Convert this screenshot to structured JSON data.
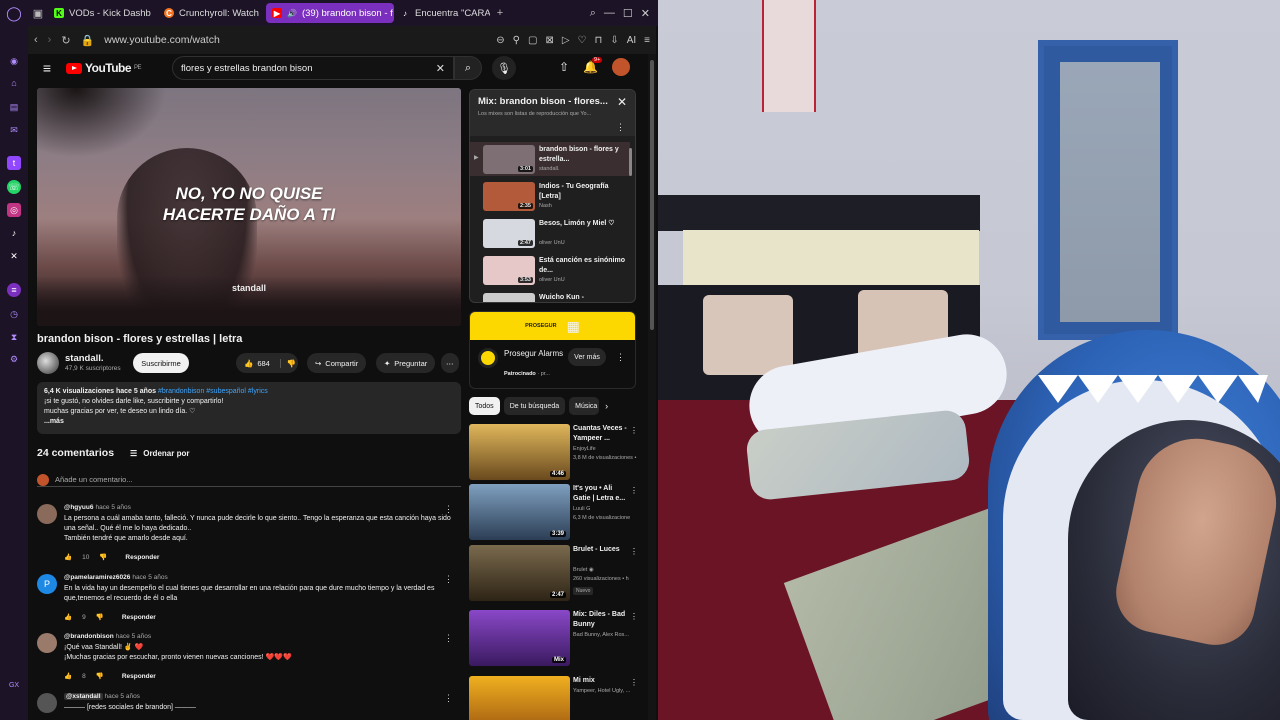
{
  "browser": {
    "tabs": [
      {
        "label": "VODs - Kick Dashb",
        "favicon": "K",
        "color": "#53fc18"
      },
      {
        "label": "Crunchyroll: Watch",
        "favicon": "C",
        "color": "#f47521"
      },
      {
        "label": "(39) brandon bison - f",
        "favicon": "▶",
        "color": "#ff0000",
        "active": true
      },
      {
        "label": "Encuentra \"CARA D",
        "favicon": "♪",
        "color": "#ffffff"
      }
    ],
    "url": "www.youtube.com/watch",
    "ai_label": "AI"
  },
  "youtube": {
    "logo_text": "YouTube",
    "region": "PE",
    "search_value": "flores y estrellas brandon bison",
    "notifications": "9+",
    "video": {
      "lyric_line1": "NO, YO NO QUISE",
      "lyric_line2": "HACERTE DAÑO A TI",
      "watermark": "standall",
      "title": "brandon bison - flores y estrellas | letra",
      "channel": "standall.",
      "subscribers": "47,9 K suscriptores",
      "subscribe_label": "Suscribirme",
      "likes": "684",
      "share_label": "Compartir",
      "ask_label": "Preguntar"
    },
    "description": {
      "meta": "6,4 K visualizaciones  hace 5 años",
      "tags": "#brandonbison #subespañol #lyrics",
      "line1": "¡si te gustó, no olvides darle like, suscribirte y compartirlo!",
      "line2": "muchas gracias por ver, te deseo un lindo día. ♡",
      "more": "...más"
    },
    "comments": {
      "count": "24 comentarios",
      "sort_label": "Ordenar por",
      "add_placeholder": "Añade un comentario...",
      "items": [
        {
          "user": "@hgyuu6",
          "time": "hace 5 años",
          "text": "La persona a cuál amaba tanto, falleció. Y nunca pude decirle lo que siento.. Tengo la esperanza que esta canción haya sido una señal.. Qué él me lo haya dedicado..",
          "text2": "También tendré que amarlo desde aquí.",
          "likes": "10",
          "reply": "Responder",
          "avatar_color": "#8a6a5a"
        },
        {
          "user": "@pamelaramirez6026",
          "time": "hace 5 años",
          "text": "En la vida hay un desempeño el cual tienes que desarrollar en una relación para que dure mucho tiempo y la verdad es que,tenemos el recuerdo de él o ella",
          "text2": "",
          "likes": "9",
          "reply": "Responder",
          "avatar_color": "#1e88e5",
          "initial": "P"
        },
        {
          "user": "@brandonbison",
          "time": "hace 5 años",
          "text": "¡Qué vaa Standall! ✌️ ❤️",
          "text2": "¡Muchas gracias por escuchar, pronto vienen nuevas canciones! ❤️❤️❤️",
          "likes": "8",
          "reply": "Responder",
          "avatar_color": "#9a7a6a"
        },
        {
          "user": "@xstandall",
          "time": "hace 5 años",
          "text": "——— [redes sociales de brandon] ———",
          "text2": "",
          "likes": "",
          "reply": "",
          "avatar_color": "#555"
        }
      ]
    },
    "mix": {
      "title": "Mix: brandon bison - flores...",
      "subtitle": "Los mixes son listas de reproducción que Yo...",
      "items": [
        {
          "name": "brandon bison - flores y estrella...",
          "by": "standall.",
          "dur": "3:01",
          "color": "#7d6f73",
          "active": true
        },
        {
          "name": "Indios - Tu Geografía [Letra]",
          "by": "Nash",
          "dur": "2:35",
          "color": "#b25a3a"
        },
        {
          "name": "Besos, Limón y Miel ♡",
          "by": "oliver UnU",
          "dur": "2:47",
          "color": "#d7d9e0"
        },
        {
          "name": "Está canción es sinónimo de...",
          "by": "oliver UnU",
          "dur": "3:53",
          "color": "#e6c8c8"
        },
        {
          "name": "Wuicho Kun -",
          "by": "",
          "dur": "",
          "color": "#cccccc"
        }
      ]
    },
    "ad": {
      "brand_banner": "PROSEGUR",
      "name": "Prosegur Alarms",
      "sponsored": "Patrocinado",
      "sponsor_suffix": "· pr...",
      "cta": "Ver más"
    },
    "chips": [
      "Todos",
      "De tu búsqueda",
      "Música"
    ],
    "recommendations": [
      {
        "title": "Cuantas Veces - Yampeer ...",
        "channel": "EnjoyLife",
        "views": "3,8 M de visualizaciones •",
        "dur": "4:46",
        "color": "#c99a3c",
        "badge": ""
      },
      {
        "title": "It's you • Ali Gatie | Letra e...",
        "channel": "Luuli G",
        "views": "6,3 M de visualizacione",
        "dur": "3:39",
        "color": "#5d7fa0",
        "badge": ""
      },
      {
        "title": "Brulet - Luces",
        "channel": "Brulet ◉",
        "views": "260 visualizaciones • h",
        "dur": "2:47",
        "color": "#5a4a32",
        "badge": "Nuevo"
      },
      {
        "title": "Mix: Diles - Bad Bunny",
        "channel": "Bad Bunny, Alex Ros...",
        "views": "",
        "dur": "Mix",
        "color": "#6b2fa0",
        "badge": ""
      },
      {
        "title": "Mi mix",
        "channel": "Yampeer, Hotel Ugly, ...",
        "views": "",
        "dur": "",
        "color": "#d49a20",
        "badge": ""
      }
    ]
  },
  "icons": {
    "sidebar": [
      "aria-icon",
      "speed-dial-icon",
      "bookmarks-icon",
      "messenger-icon",
      "twitch-icon",
      "whatsapp-icon",
      "instagram-icon",
      "tiktok-icon",
      "x-icon",
      "music-icon",
      "history-icon",
      "clock-icon",
      "settings-icon"
    ],
    "gx_label": "GX"
  }
}
